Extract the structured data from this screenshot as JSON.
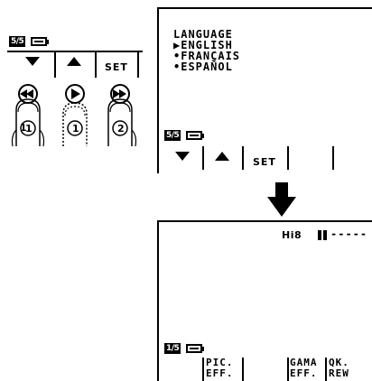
{
  "left_panel": {
    "page_badge": "5/5",
    "set_label": "SET",
    "finger_labels": [
      "1",
      "1",
      "2"
    ],
    "button_icons": [
      "rewind-icon",
      "play-icon",
      "fast-forward-icon"
    ]
  },
  "menu_screen": {
    "title": "LANGUAGE",
    "options": [
      {
        "marker": "▶",
        "label": "ENGLISH"
      },
      {
        "marker": "•",
        "label": "FRANÇAIS"
      },
      {
        "marker": "•",
        "label": "ESPAÑOL"
      }
    ],
    "page_badge": "5/5",
    "set_label": "SET"
  },
  "result_screen": {
    "format_label": "Hi8",
    "tape_counter": "-----",
    "page_badge": "1/5",
    "soft_keys": [
      {
        "line1": "PIC.",
        "line2": "EFF."
      },
      {
        "line1": "GAMA",
        "line2": "EFF."
      },
      {
        "line1": "QK.",
        "line2": "REW"
      }
    ]
  },
  "arrow_icon": "arrow-down-icon"
}
